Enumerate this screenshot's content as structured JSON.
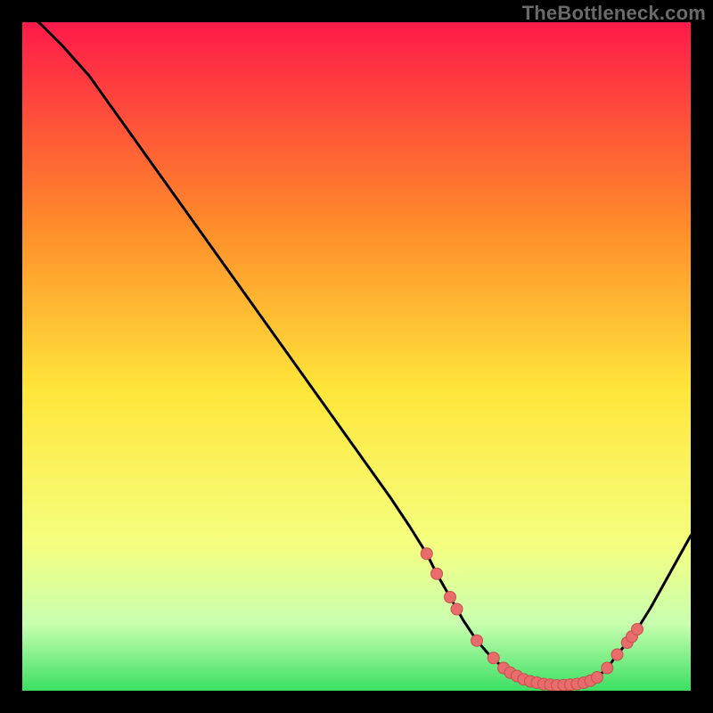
{
  "watermark": "TheBottleneck.com",
  "colors": {
    "frame": "#000000",
    "gradient_top": "#ff1a4a",
    "gradient_upper_mid": "#ff8a2a",
    "gradient_mid": "#ffe63a",
    "gradient_lower_mid": "#f5ff80",
    "gradient_green_pale": "#c8ffb0",
    "gradient_green": "#3bdf62",
    "curve": "#000000",
    "marker_fill": "#e86c6c",
    "marker_stroke": "#c94f4f"
  },
  "chart_data": {
    "type": "line",
    "title": "",
    "xlabel": "",
    "ylabel": "",
    "xlim": [
      0,
      100
    ],
    "ylim": [
      0,
      100
    ],
    "x": [
      0,
      3,
      6,
      10,
      15,
      20,
      25,
      30,
      35,
      40,
      45,
      50,
      55,
      58,
      60.5,
      62,
      64,
      66,
      68,
      70,
      72,
      74,
      76,
      78,
      80,
      82,
      84,
      86,
      87.5,
      89,
      90.5,
      92,
      94,
      96,
      98,
      100
    ],
    "y": [
      102,
      99.5,
      96.5,
      92,
      85,
      78,
      71,
      64,
      57,
      50,
      43,
      36,
      29,
      24.5,
      20.5,
      17.5,
      14,
      10.5,
      7.5,
      5.2,
      3.4,
      2.2,
      1.4,
      1.0,
      0.8,
      0.9,
      1.2,
      2.0,
      3.4,
      5.4,
      7.2,
      9.2,
      12.4,
      16.0,
      19.6,
      23.2
    ],
    "marker_points": [
      {
        "x": 60.5,
        "y": 20.5
      },
      {
        "x": 62,
        "y": 17.5
      },
      {
        "x": 64,
        "y": 14
      },
      {
        "x": 65,
        "y": 12.2
      },
      {
        "x": 68,
        "y": 7.5
      },
      {
        "x": 70.5,
        "y": 4.9
      },
      {
        "x": 72,
        "y": 3.4
      },
      {
        "x": 73,
        "y": 2.7
      },
      {
        "x": 74,
        "y": 2.2
      },
      {
        "x": 75,
        "y": 1.7
      },
      {
        "x": 76,
        "y": 1.4
      },
      {
        "x": 77,
        "y": 1.2
      },
      {
        "x": 78,
        "y": 1.0
      },
      {
        "x": 79,
        "y": 0.9
      },
      {
        "x": 80,
        "y": 0.8
      },
      {
        "x": 81,
        "y": 0.85
      },
      {
        "x": 82,
        "y": 0.9
      },
      {
        "x": 83,
        "y": 1.0
      },
      {
        "x": 84,
        "y": 1.2
      },
      {
        "x": 85,
        "y": 1.5
      },
      {
        "x": 86,
        "y": 2.0
      },
      {
        "x": 87.5,
        "y": 3.4
      },
      {
        "x": 89,
        "y": 5.4
      },
      {
        "x": 90.5,
        "y": 7.2
      },
      {
        "x": 91.2,
        "y": 8.1
      },
      {
        "x": 92,
        "y": 9.2
      }
    ]
  }
}
